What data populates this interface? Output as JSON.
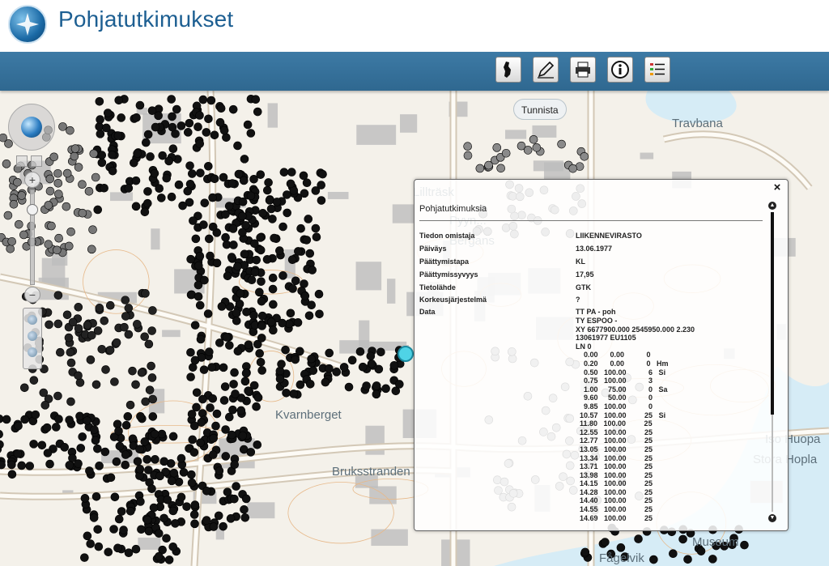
{
  "header": {
    "title": "Pohjatutkimukset",
    "logo_icon": "compass-logo-icon"
  },
  "toolbar": {
    "buttons": [
      {
        "name": "map-finland-button",
        "icon": "finland-map-icon"
      },
      {
        "name": "draw-tool-button",
        "icon": "pencil-icon"
      },
      {
        "name": "print-button",
        "icon": "printer-icon"
      },
      {
        "name": "info-button",
        "icon": "info-icon"
      },
      {
        "name": "legend-button",
        "icon": "list-icon"
      }
    ],
    "tooltip": "Tunnista"
  },
  "map": {
    "labels": [
      "Travbana",
      "Kvarnberget",
      "Bruksstranden",
      "Iso Huopa",
      "Stora Hopla",
      "Museum",
      "Fågelvik",
      "Bergans",
      "Pyyn...",
      "Lillträsk"
    ]
  },
  "popup": {
    "title": "Pohjatutkimuksia",
    "close_label": "×",
    "fields": [
      {
        "key": "Tiedon omistaja",
        "value": "LIIKENNEVIRASTO"
      },
      {
        "key": "Päiväys",
        "value": "13.06.1977"
      },
      {
        "key": "Päättymistapa",
        "value": "KL"
      },
      {
        "key": "Päättymissyvyys",
        "value": "17,95"
      },
      {
        "key": "Tietolähde",
        "value": "GTK"
      },
      {
        "key": "Korkeusjärjestelmä",
        "value": "?"
      },
      {
        "key": "Data",
        "value": "TT PA - poh"
      }
    ],
    "data_lines": [
      "TY ESPOO -",
      "XY 6677900.000 2545950.000 2.230",
      "13061977 EU1105",
      "LN 0",
      "    0.00      0.00           0",
      "    0.20      0.00           0   Hm",
      "    0.50   100.00           6   Si",
      "    0.75   100.00           3",
      "    1.00     75.00           0   Sa",
      "    9.60     50.00           0",
      "    9.85   100.00           0",
      "  10.57   100.00         25   Si",
      "  11.80   100.00         25",
      "  12.55   100.00         25",
      "  12.77   100.00         25",
      "  13.05   100.00         25",
      "  13.34   100.00         25",
      "  13.71   100.00         25",
      "  13.98   100.00         25",
      "  14.15   100.00         25",
      "  14.28   100.00         25",
      "  14.40   100.00         25",
      "  14.55   100.00         25",
      "  14.69   100.00         25"
    ]
  }
}
